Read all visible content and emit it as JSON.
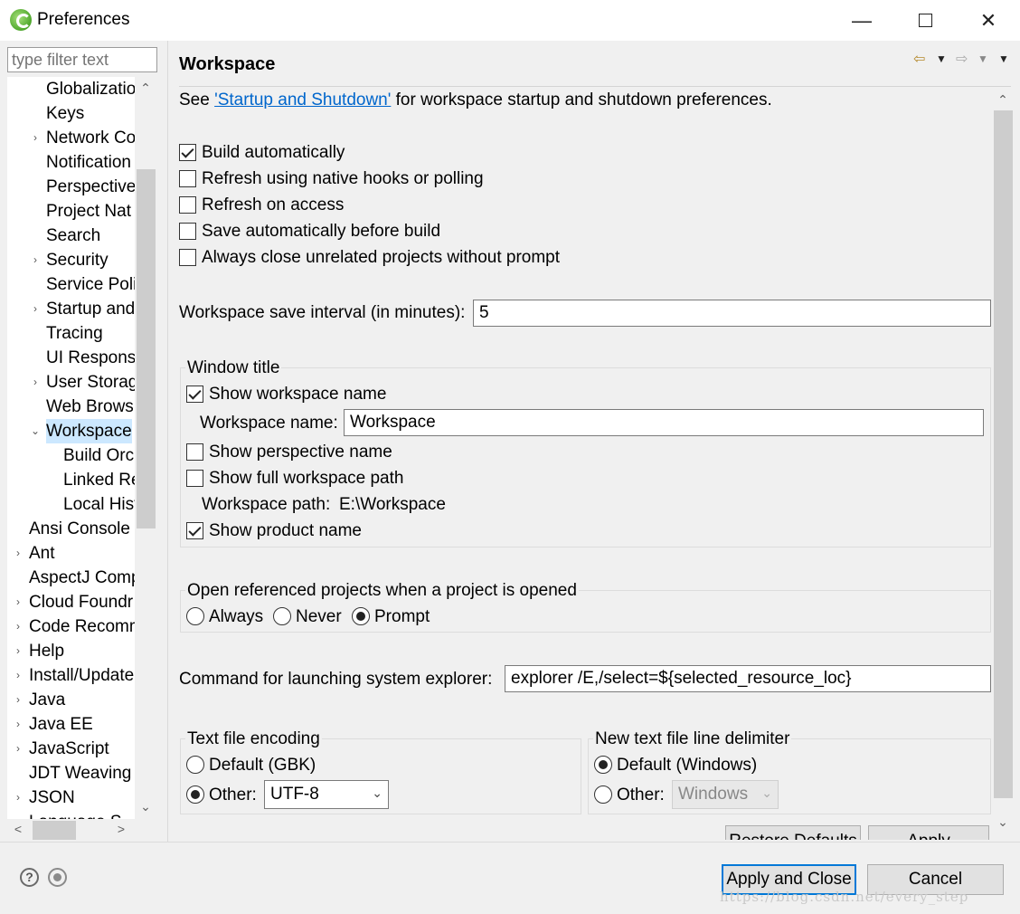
{
  "window": {
    "title": "Preferences"
  },
  "filter": {
    "placeholder": "type filter text"
  },
  "tree": {
    "items": [
      {
        "label": "Globalizatio",
        "indent": 1,
        "twisty": ""
      },
      {
        "label": "Keys",
        "indent": 1,
        "twisty": ""
      },
      {
        "label": "Network Co",
        "indent": 1,
        "twisty": "›"
      },
      {
        "label": "Notification",
        "indent": 1,
        "twisty": ""
      },
      {
        "label": "Perspective",
        "indent": 1,
        "twisty": ""
      },
      {
        "label": "Project Nat",
        "indent": 1,
        "twisty": ""
      },
      {
        "label": "Search",
        "indent": 1,
        "twisty": ""
      },
      {
        "label": "Security",
        "indent": 1,
        "twisty": "›"
      },
      {
        "label": "Service Poli",
        "indent": 1,
        "twisty": ""
      },
      {
        "label": "Startup and",
        "indent": 1,
        "twisty": "›"
      },
      {
        "label": "Tracing",
        "indent": 1,
        "twisty": ""
      },
      {
        "label": "UI Responsi",
        "indent": 1,
        "twisty": ""
      },
      {
        "label": "User Storag",
        "indent": 1,
        "twisty": "›"
      },
      {
        "label": "Web Brows",
        "indent": 1,
        "twisty": ""
      },
      {
        "label": "Workspace",
        "indent": 1,
        "twisty": "⌄",
        "selected": true
      },
      {
        "label": "Build Orc",
        "indent": 2,
        "twisty": ""
      },
      {
        "label": "Linked Re",
        "indent": 2,
        "twisty": ""
      },
      {
        "label": "Local Hist",
        "indent": 2,
        "twisty": ""
      },
      {
        "label": "Ansi Console",
        "indent": 0,
        "twisty": ""
      },
      {
        "label": "Ant",
        "indent": 0,
        "twisty": "›"
      },
      {
        "label": "AspectJ Comp",
        "indent": 0,
        "twisty": ""
      },
      {
        "label": "Cloud Foundr",
        "indent": 0,
        "twisty": "›"
      },
      {
        "label": "Code Recomm",
        "indent": 0,
        "twisty": "›"
      },
      {
        "label": "Help",
        "indent": 0,
        "twisty": "›"
      },
      {
        "label": "Install/Update",
        "indent": 0,
        "twisty": "›"
      },
      {
        "label": "Java",
        "indent": 0,
        "twisty": "›"
      },
      {
        "label": "Java EE",
        "indent": 0,
        "twisty": "›"
      },
      {
        "label": "JavaScript",
        "indent": 0,
        "twisty": "›"
      },
      {
        "label": "JDT Weaving",
        "indent": 0,
        "twisty": ""
      },
      {
        "label": "JSON",
        "indent": 0,
        "twisty": "›"
      },
      {
        "label": "Language S",
        "indent": 0,
        "twisty": "›"
      }
    ]
  },
  "page": {
    "title": "Workspace",
    "intro_prefix": "See ",
    "intro_link": "'Startup and Shutdown'",
    "intro_suffix": " for workspace startup and shutdown preferences.",
    "options": [
      {
        "label": "Build automatically",
        "checked": true
      },
      {
        "label": "Refresh using native hooks or polling",
        "checked": false
      },
      {
        "label": "Refresh on access",
        "checked": false
      },
      {
        "label": "Save automatically before build",
        "checked": false
      },
      {
        "label": "Always close unrelated projects without prompt",
        "checked": false
      }
    ],
    "save_interval_label": "Workspace save interval (in minutes):",
    "save_interval_value": "5",
    "window_title": {
      "group_label": "Window title",
      "show_workspace_name": "Show workspace name",
      "workspace_name_label": "Workspace name:",
      "workspace_name_value": "Workspace",
      "show_perspective_name": "Show perspective name",
      "show_full_path": "Show full workspace path",
      "workspace_path_label": "Workspace path:",
      "workspace_path_value": "E:\\Workspace",
      "show_product_name": "Show product name"
    },
    "open_referenced": {
      "group_label": "Open referenced projects when a project is opened",
      "always": "Always",
      "never": "Never",
      "prompt": "Prompt",
      "selected": "Prompt"
    },
    "explorer_label": "Command for launching system explorer:",
    "explorer_value": "explorer /E,/select=${selected_resource_loc}",
    "encoding": {
      "group_label": "Text file encoding",
      "default_label": "Default (GBK)",
      "other_label": "Other:",
      "other_value": "UTF-8",
      "selected": "Other"
    },
    "delimiter": {
      "group_label": "New text file line delimiter",
      "default_label": "Default (Windows)",
      "other_label": "Other:",
      "other_value": "Windows",
      "selected": "Default"
    },
    "restore_defaults_label": "Restore Defaults",
    "apply_label": "Apply"
  },
  "footer": {
    "apply_close_label": "Apply and Close",
    "cancel_label": "Cancel",
    "watermark": "https://blog.csdn.net/every_step"
  }
}
